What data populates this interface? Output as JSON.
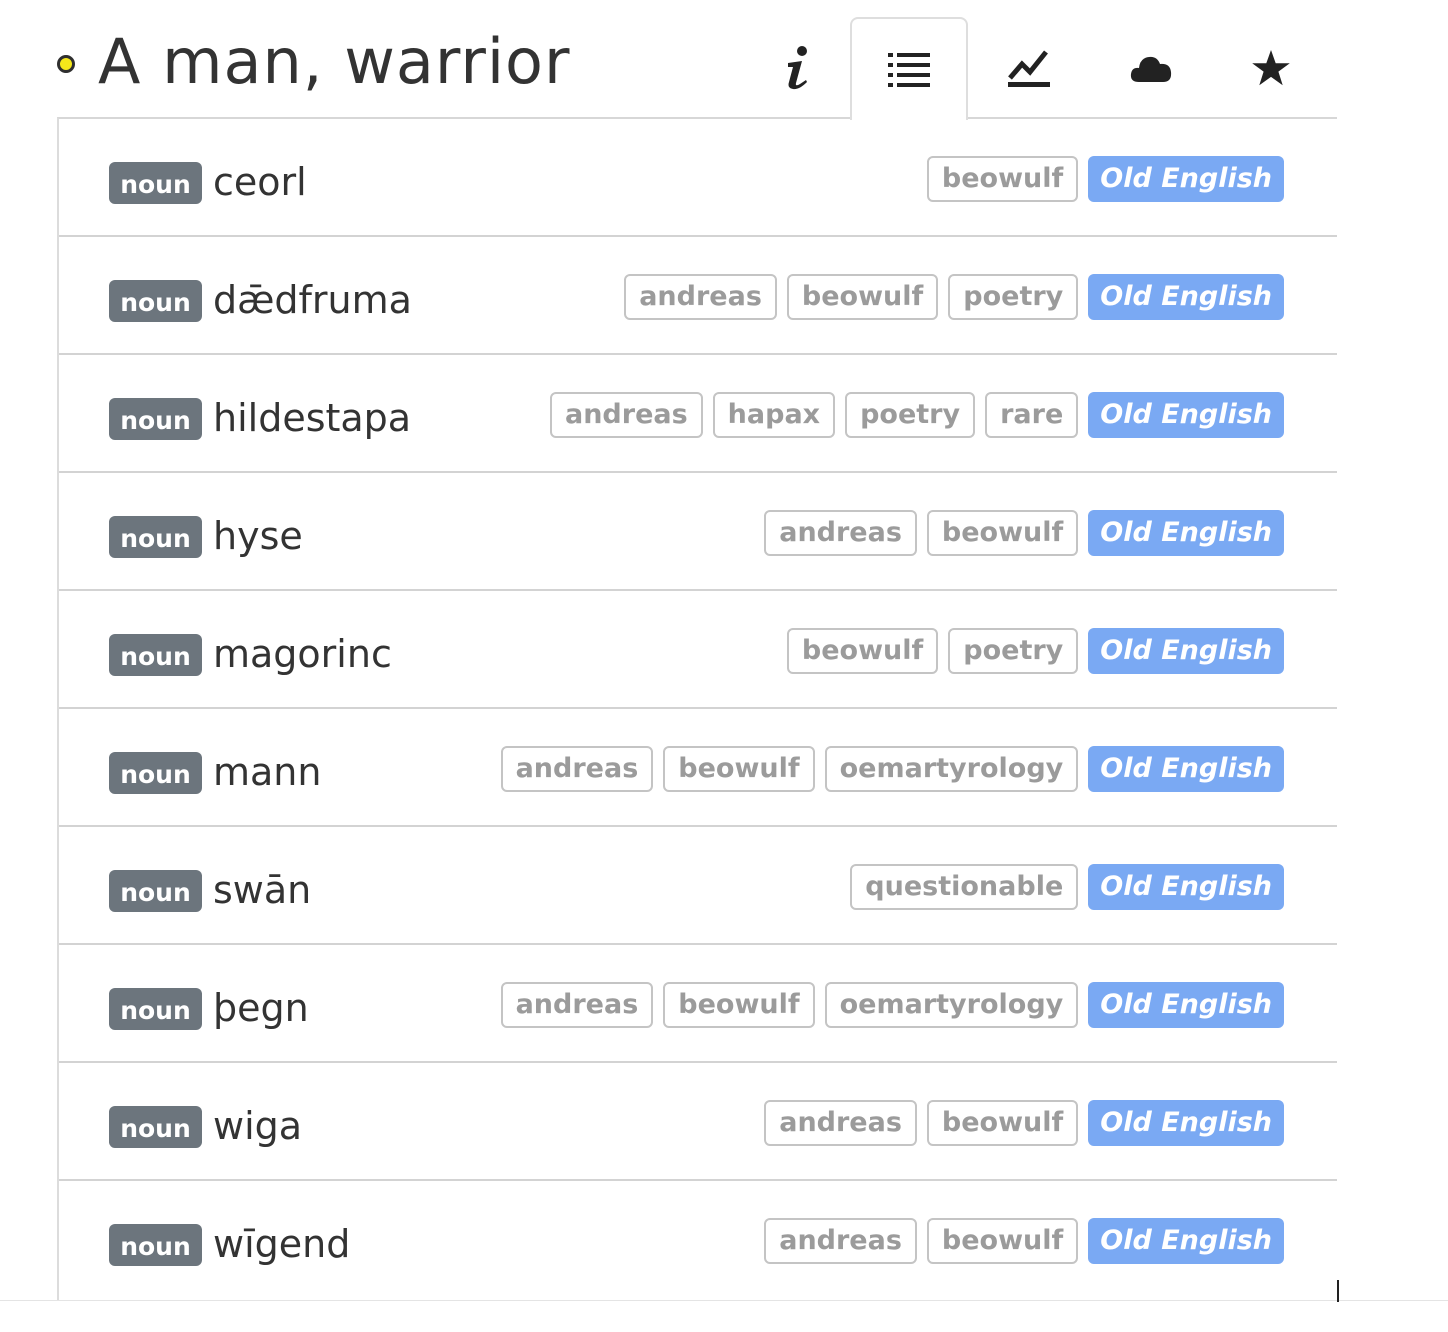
{
  "header": {
    "title": "A man, warrior"
  },
  "tabs": [
    {
      "name": "info",
      "icon": "info-icon",
      "active": false
    },
    {
      "name": "list",
      "icon": "list-icon",
      "active": true
    },
    {
      "name": "chart",
      "icon": "chart-line-icon",
      "active": false
    },
    {
      "name": "cloud",
      "icon": "cloud-icon",
      "active": false
    },
    {
      "name": "star",
      "icon": "star-icon",
      "active": false
    }
  ],
  "colors": {
    "badge": "#6c757d",
    "language": "#7aa9f3",
    "title_dot": "#f5e81b"
  },
  "entries": [
    {
      "pos": "noun",
      "word": "ceorl",
      "tags": [
        "beowulf"
      ],
      "language": "Old English"
    },
    {
      "pos": "noun",
      "word": "dǣdfruma",
      "tags": [
        "andreas",
        "beowulf",
        "poetry"
      ],
      "language": "Old English"
    },
    {
      "pos": "noun",
      "word": "hildestapa",
      "tags": [
        "andreas",
        "hapax",
        "poetry",
        "rare"
      ],
      "language": "Old English"
    },
    {
      "pos": "noun",
      "word": "hyse",
      "tags": [
        "andreas",
        "beowulf"
      ],
      "language": "Old English"
    },
    {
      "pos": "noun",
      "word": "magorinc",
      "tags": [
        "beowulf",
        "poetry"
      ],
      "language": "Old English"
    },
    {
      "pos": "noun",
      "word": "mann",
      "tags": [
        "andreas",
        "beowulf",
        "oemartyrology"
      ],
      "language": "Old English"
    },
    {
      "pos": "noun",
      "word": "swān",
      "tags": [
        "questionable"
      ],
      "language": "Old English"
    },
    {
      "pos": "noun",
      "word": "þegn",
      "tags": [
        "andreas",
        "beowulf",
        "oemartyrology"
      ],
      "language": "Old English"
    },
    {
      "pos": "noun",
      "word": "wiga",
      "tags": [
        "andreas",
        "beowulf"
      ],
      "language": "Old English"
    },
    {
      "pos": "noun",
      "word": "wīgend",
      "tags": [
        "andreas",
        "beowulf"
      ],
      "language": "Old English"
    }
  ]
}
